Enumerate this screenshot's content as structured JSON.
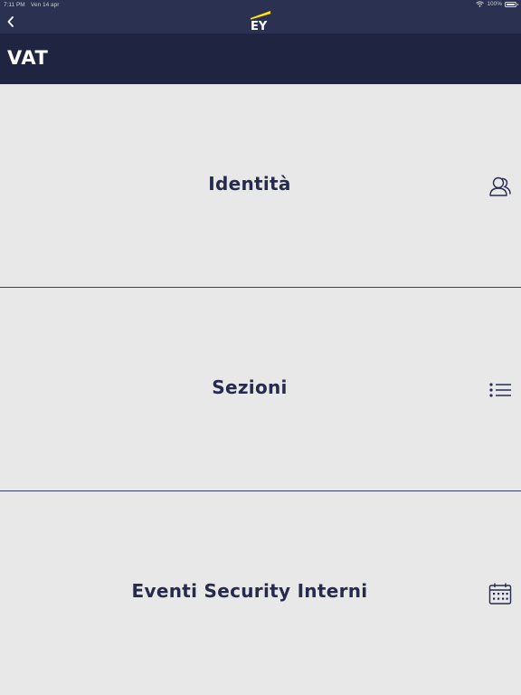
{
  "status_bar": {
    "time": "7:11 PM",
    "date": "Ven 14 apr",
    "battery": "100%"
  },
  "nav": {
    "back_icon": "chevron-left-icon",
    "logo_text": "EY",
    "logo_accent": "#ffe600"
  },
  "header": {
    "title": "VAT"
  },
  "menu": {
    "items": [
      {
        "label": "Identità",
        "icon": "user-icon"
      },
      {
        "label": "Sezioni",
        "icon": "list-icon"
      },
      {
        "label": "Eventi Security Interni",
        "icon": "calendar-icon"
      }
    ]
  },
  "colors": {
    "nav_bg": "#2b3150",
    "title_bg": "#1f2541",
    "body_bg": "#e8e8e8",
    "text": "#262b4d"
  }
}
